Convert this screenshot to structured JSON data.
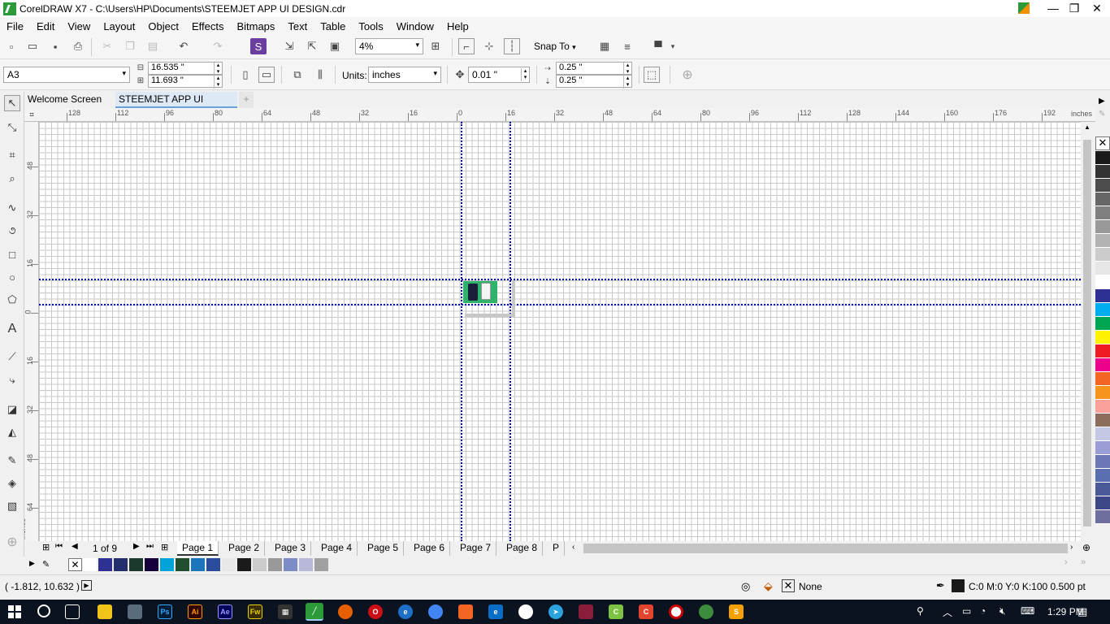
{
  "window": {
    "title": "CorelDRAW X7 - C:\\Users\\HP\\Documents\\STEEMJET APP UI DESIGN.cdr",
    "minimize": "—",
    "maximize": "❐",
    "close": "✕"
  },
  "menu": [
    {
      "label": "File"
    },
    {
      "label": "Edit"
    },
    {
      "label": "View"
    },
    {
      "label": "Layout"
    },
    {
      "label": "Object"
    },
    {
      "label": "Effects"
    },
    {
      "label": "Bitmaps"
    },
    {
      "label": "Text"
    },
    {
      "label": "Table"
    },
    {
      "label": "Tools"
    },
    {
      "label": "Window"
    },
    {
      "label": "Help"
    }
  ],
  "standard_toolbar": {
    "zoom_level": "4%",
    "snap_to": "Snap To"
  },
  "property_bar": {
    "page_size": "A3",
    "width": "16.535 \"",
    "height": "11.693 \"",
    "units_label": "Units:",
    "units_value": "inches",
    "nudge": "0.01 \"",
    "dup_x": "0.25 \"",
    "dup_y": "0.25 \""
  },
  "doc_tabs": [
    {
      "label": "Welcome Screen"
    },
    {
      "label": "STEEMJET APP UI DESI..."
    }
  ],
  "ruler_top": {
    "labels": [
      "128",
      "112",
      "96",
      "80",
      "64",
      "48",
      "32",
      "16",
      "0",
      "16",
      "32",
      "48",
      "64",
      "80",
      "96",
      "112",
      "128",
      "144",
      "160",
      "176",
      "192"
    ],
    "unit": "inches"
  },
  "ruler_left": {
    "labels": [
      "48",
      "32",
      "16",
      "0",
      "16",
      "32",
      "48",
      "64"
    ],
    "unit": "inches"
  },
  "page_nav": {
    "counter": "1 of 9",
    "pages": [
      "Page 1",
      "Page 2",
      "Page 3",
      "Page 4",
      "Page 5",
      "Page 6",
      "Page 7",
      "Page 8",
      "P"
    ],
    "active": "Page 1"
  },
  "colors": {
    "guide": "#0000a8",
    "page_green": "#2fb36a",
    "right_palette": [
      "#ffffff",
      "#1a1a1a",
      "#333333",
      "#4d4d4d",
      "#666666",
      "#808080",
      "#999999",
      "#b3b3b3",
      "#cccccc",
      "#e6e6e6",
      "#ffffff",
      "#2e3192",
      "#00aeef",
      "#00a651",
      "#fff200",
      "#ed1c24",
      "#ec008c",
      "#f26522",
      "#f7941d",
      "#f9a19a",
      "#8b6d5c",
      "#c4c8e5",
      "#9b9ed6",
      "#6c77b8",
      "#5a6fb0",
      "#4a5a99",
      "#3b4786",
      "#6d6d9e"
    ],
    "doc_palette": [
      "#ffffff",
      "#2e3192",
      "#24306e",
      "#1b3a2b",
      "#16003b",
      "#00a3d9",
      "#1f4d2e",
      "#1b75bc",
      "#2b4c9b",
      "#e8e8e8",
      "#1a1a1a",
      "#cccccc",
      "#999999",
      "#7d8cc4",
      "#b8b8d8",
      "#a0a0a0"
    ]
  },
  "status": {
    "coords": "( -1.812, 10.632 )",
    "fill": "None",
    "outline": "C:0 M:0 Y:0 K:100  0.500 pt"
  },
  "taskbar": {
    "clock": "1:29 PM",
    "apps": [
      "Ps",
      "Ai",
      "Ae",
      "Fw"
    ]
  }
}
